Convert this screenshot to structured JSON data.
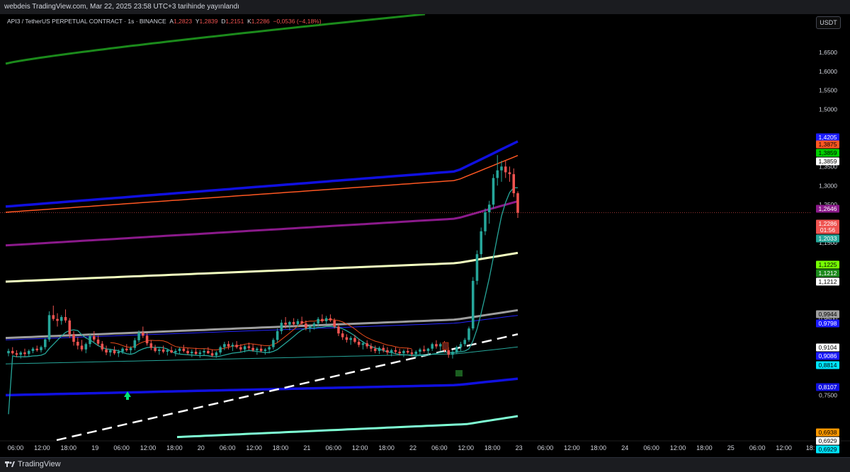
{
  "header": {
    "publish_note": "webdeis TradingView.com, Mar 22, 2025 23:58 UTC+3 tarihinde yayınlandı"
  },
  "symbol": {
    "name": "API3 / TetherUS PERPETUAL CONTRACT · 1s · BINANCE",
    "o_label": "A",
    "o_value": "1,2823",
    "h_label": "Y",
    "h_value": "1,2839",
    "l_label": "D",
    "l_value": "1,2151",
    "c_label": "K",
    "c_value": "1,2286",
    "change": "−0,0536 (−4,18%)"
  },
  "currency_button": "USDT",
  "brand": "TradingView",
  "colors": {
    "background": "#000000",
    "up": "#26a69a",
    "down": "#ef5350",
    "green_band": "#1b8a1b",
    "blue_band": "#1010e0",
    "orange_ma": "#ff5722",
    "purple_ma": "#8b1a8b",
    "yellow_band": "#f3ffc0",
    "gray_ma": "#9e9e9e",
    "teal_ma": "#26a69a",
    "aqua_band": "#7fffd4",
    "white_dash": "#ffffff"
  },
  "chart_data": {
    "type": "candlestick",
    "timeframe": "1h",
    "x_ticks": [
      "06:00",
      "12:00",
      "18:00",
      "19",
      "06:00",
      "12:00",
      "18:00",
      "20",
      "06:00",
      "12:00",
      "18:00",
      "21",
      "06:00",
      "12:00",
      "18:00",
      "22",
      "06:00",
      "12:00",
      "18:00",
      "23",
      "06:00",
      "12:00",
      "18:00",
      "24",
      "06:00",
      "12:00",
      "18:00",
      "25",
      "06:00",
      "12:00",
      "18:"
    ],
    "y_ticks": [
      "1,6500",
      "1,6000",
      "1,5500",
      "1,5000",
      "1,3500",
      "1,3000",
      "1,2500",
      "1,1500",
      "1,0500",
      "0,9500",
      "0,8500",
      "0,7500"
    ],
    "ylim": [
      0.63,
      1.75
    ],
    "price_tags": [
      {
        "value": "1,4205",
        "bg": "#1a1aff",
        "fg": "#ffffff"
      },
      {
        "value": "1,3875",
        "bg": "#ff5722",
        "fg": "#000000"
      },
      {
        "value": "1,3859",
        "bg": "#00d000",
        "fg": "#000000"
      },
      {
        "value": "1,3859",
        "bg": "#ffffff",
        "fg": "#000000"
      },
      {
        "value": "1,2646",
        "bg": "#8b1a8b",
        "fg": "#ffffff"
      },
      {
        "value": "1,2286",
        "bg": "#ef5350",
        "fg": "#ffffff"
      },
      {
        "value": "01:56",
        "bg": "#ef5350",
        "fg": "#ffffff"
      },
      {
        "value": "1,2033",
        "bg": "#26a69a",
        "fg": "#ffffff"
      },
      {
        "value": "1,1225",
        "bg": "#76ff03",
        "fg": "#000000"
      },
      {
        "value": "1,1212",
        "bg": "#1b8a1b",
        "fg": "#ffffff"
      },
      {
        "value": "1,1212",
        "bg": "#ffffff",
        "fg": "#000000"
      },
      {
        "value": "0,9944",
        "bg": "#9e9e9e",
        "fg": "#000000"
      },
      {
        "value": "0,9798",
        "bg": "#1a1aff",
        "fg": "#ffffff"
      },
      {
        "value": "0,9104",
        "bg": "#ffffff",
        "fg": "#000000"
      },
      {
        "value": "0,9086",
        "bg": "#1a1aff",
        "fg": "#ffffff"
      },
      {
        "value": "0,8814",
        "bg": "#00e5ff",
        "fg": "#000000"
      },
      {
        "value": "0,8107",
        "bg": "#1010e0",
        "fg": "#ffffff"
      },
      {
        "value": "0,6938",
        "bg": "#ff9800",
        "fg": "#000000"
      },
      {
        "value": "0,6929",
        "bg": "#ffffff",
        "fg": "#000000"
      },
      {
        "value": "0,6929",
        "bg": "#00e5ff",
        "fg": "#000000"
      }
    ],
    "candles": [
      [
        0.86,
        0.872,
        0.852,
        0.866
      ],
      [
        0.866,
        0.876,
        0.856,
        0.86
      ],
      [
        0.86,
        0.868,
        0.85,
        0.856
      ],
      [
        0.856,
        0.866,
        0.846,
        0.862
      ],
      [
        0.862,
        0.872,
        0.852,
        0.858
      ],
      [
        0.858,
        0.87,
        0.852,
        0.866
      ],
      [
        0.866,
        0.876,
        0.86,
        0.872
      ],
      [
        0.872,
        0.88,
        0.864,
        0.868
      ],
      [
        0.868,
        0.88,
        0.862,
        0.876
      ],
      [
        0.876,
        0.9,
        0.87,
        0.896
      ],
      [
        0.896,
        0.97,
        0.89,
        0.96
      ],
      [
        0.96,
        0.985,
        0.945,
        0.95
      ],
      [
        0.95,
        0.965,
        0.93,
        0.945
      ],
      [
        0.945,
        0.96,
        0.935,
        0.955
      ],
      [
        0.955,
        0.975,
        0.94,
        0.946
      ],
      [
        0.946,
        0.952,
        0.9,
        0.91
      ],
      [
        0.91,
        0.918,
        0.88,
        0.89
      ],
      [
        0.89,
        0.902,
        0.87,
        0.88
      ],
      [
        0.88,
        0.895,
        0.865,
        0.87
      ],
      [
        0.87,
        0.888,
        0.86,
        0.884
      ],
      [
        0.884,
        0.91,
        0.876,
        0.905
      ],
      [
        0.905,
        0.918,
        0.89,
        0.896
      ],
      [
        0.896,
        0.906,
        0.88,
        0.885
      ],
      [
        0.885,
        0.892,
        0.865,
        0.87
      ],
      [
        0.87,
        0.88,
        0.855,
        0.862
      ],
      [
        0.862,
        0.872,
        0.852,
        0.868
      ],
      [
        0.868,
        0.878,
        0.856,
        0.86
      ],
      [
        0.86,
        0.87,
        0.85,
        0.864
      ],
      [
        0.864,
        0.876,
        0.858,
        0.872
      ],
      [
        0.872,
        0.884,
        0.864,
        0.868
      ],
      [
        0.868,
        0.878,
        0.858,
        0.874
      ],
      [
        0.874,
        0.9,
        0.868,
        0.894
      ],
      [
        0.894,
        0.92,
        0.888,
        0.914
      ],
      [
        0.914,
        0.93,
        0.9,
        0.906
      ],
      [
        0.906,
        0.912,
        0.88,
        0.886
      ],
      [
        0.886,
        0.894,
        0.868,
        0.874
      ],
      [
        0.874,
        0.882,
        0.862,
        0.866
      ],
      [
        0.866,
        0.874,
        0.856,
        0.87
      ],
      [
        0.87,
        0.88,
        0.86,
        0.864
      ],
      [
        0.864,
        0.872,
        0.854,
        0.868
      ],
      [
        0.868,
        0.878,
        0.86,
        0.862
      ],
      [
        0.862,
        0.872,
        0.852,
        0.866
      ],
      [
        0.866,
        0.876,
        0.858,
        0.872
      ],
      [
        0.872,
        0.882,
        0.862,
        0.866
      ],
      [
        0.866,
        0.874,
        0.856,
        0.86
      ],
      [
        0.86,
        0.87,
        0.85,
        0.864
      ],
      [
        0.864,
        0.874,
        0.856,
        0.858
      ],
      [
        0.858,
        0.868,
        0.848,
        0.862
      ],
      [
        0.862,
        0.872,
        0.854,
        0.866
      ],
      [
        0.866,
        0.876,
        0.858,
        0.86
      ],
      [
        0.86,
        0.87,
        0.85,
        0.854
      ],
      [
        0.854,
        0.866,
        0.848,
        0.862
      ],
      [
        0.862,
        0.88,
        0.856,
        0.876
      ],
      [
        0.876,
        0.89,
        0.868,
        0.884
      ],
      [
        0.884,
        0.892,
        0.87,
        0.878
      ],
      [
        0.878,
        0.888,
        0.866,
        0.882
      ],
      [
        0.882,
        0.892,
        0.872,
        0.876
      ],
      [
        0.876,
        0.884,
        0.864,
        0.87
      ],
      [
        0.87,
        0.882,
        0.862,
        0.878
      ],
      [
        0.878,
        0.888,
        0.868,
        0.874
      ],
      [
        0.874,
        0.884,
        0.864,
        0.868
      ],
      [
        0.868,
        0.876,
        0.856,
        0.872
      ],
      [
        0.872,
        0.882,
        0.862,
        0.866
      ],
      [
        0.866,
        0.874,
        0.856,
        0.87
      ],
      [
        0.87,
        0.88,
        0.86,
        0.876
      ],
      [
        0.876,
        0.9,
        0.87,
        0.895
      ],
      [
        0.895,
        0.925,
        0.888,
        0.918
      ],
      [
        0.918,
        0.948,
        0.91,
        0.94
      ],
      [
        0.94,
        0.955,
        0.925,
        0.935
      ],
      [
        0.935,
        0.945,
        0.92,
        0.942
      ],
      [
        0.942,
        0.952,
        0.93,
        0.936
      ],
      [
        0.936,
        0.95,
        0.928,
        0.944
      ],
      [
        0.944,
        0.956,
        0.934,
        0.938
      ],
      [
        0.938,
        0.946,
        0.92,
        0.926
      ],
      [
        0.926,
        0.934,
        0.915,
        0.93
      ],
      [
        0.93,
        0.942,
        0.922,
        0.938
      ],
      [
        0.938,
        0.955,
        0.93,
        0.95
      ],
      [
        0.95,
        0.962,
        0.94,
        0.944
      ],
      [
        0.944,
        0.958,
        0.936,
        0.952
      ],
      [
        0.952,
        0.962,
        0.942,
        0.946
      ],
      [
        0.946,
        0.952,
        0.925,
        0.93
      ],
      [
        0.93,
        0.936,
        0.905,
        0.912
      ],
      [
        0.912,
        0.92,
        0.895,
        0.902
      ],
      [
        0.902,
        0.91,
        0.888,
        0.895
      ],
      [
        0.895,
        0.905,
        0.882,
        0.9
      ],
      [
        0.9,
        0.908,
        0.886,
        0.89
      ],
      [
        0.89,
        0.898,
        0.876,
        0.882
      ],
      [
        0.882,
        0.892,
        0.87,
        0.886
      ],
      [
        0.886,
        0.894,
        0.872,
        0.878
      ],
      [
        0.878,
        0.886,
        0.864,
        0.872
      ],
      [
        0.872,
        0.88,
        0.86,
        0.866
      ],
      [
        0.866,
        0.878,
        0.858,
        0.874
      ],
      [
        0.874,
        0.882,
        0.862,
        0.868
      ],
      [
        0.868,
        0.876,
        0.856,
        0.862
      ],
      [
        0.862,
        0.872,
        0.852,
        0.868
      ],
      [
        0.868,
        0.876,
        0.858,
        0.864
      ],
      [
        0.864,
        0.872,
        0.854,
        0.86
      ],
      [
        0.86,
        0.87,
        0.85,
        0.866
      ],
      [
        0.866,
        0.874,
        0.858,
        0.862
      ],
      [
        0.862,
        0.87,
        0.852,
        0.858
      ],
      [
        0.858,
        0.868,
        0.848,
        0.864
      ],
      [
        0.864,
        0.874,
        0.856,
        0.87
      ],
      [
        0.87,
        0.88,
        0.862,
        0.866
      ],
      [
        0.866,
        0.874,
        0.856,
        0.872
      ],
      [
        0.872,
        0.888,
        0.866,
        0.884
      ],
      [
        0.884,
        0.894,
        0.872,
        0.878
      ],
      [
        0.878,
        0.888,
        0.866,
        0.884
      ],
      [
        0.884,
        0.892,
        0.862,
        0.868
      ],
      [
        0.868,
        0.876,
        0.848,
        0.856
      ],
      [
        0.856,
        0.868,
        0.846,
        0.864
      ],
      [
        0.864,
        0.88,
        0.858,
        0.876
      ],
      [
        0.876,
        0.89,
        0.866,
        0.884
      ],
      [
        0.884,
        0.9,
        0.878,
        0.895
      ],
      [
        0.895,
        0.93,
        0.89,
        0.925
      ],
      [
        0.925,
        1.06,
        0.92,
        1.05
      ],
      [
        1.05,
        1.13,
        1.04,
        1.12
      ],
      [
        1.12,
        1.19,
        1.11,
        1.18
      ],
      [
        1.18,
        1.24,
        1.17,
        1.23
      ],
      [
        1.23,
        1.26,
        1.2,
        1.25
      ],
      [
        1.25,
        1.33,
        1.24,
        1.32
      ],
      [
        1.32,
        1.38,
        1.3,
        1.34
      ],
      [
        1.34,
        1.365,
        1.31,
        1.35
      ],
      [
        1.35,
        1.365,
        1.32,
        1.335
      ],
      [
        1.335,
        1.35,
        1.31,
        1.33
      ],
      [
        1.33,
        1.345,
        1.27,
        1.28
      ],
      [
        1.28,
        1.285,
        1.215,
        1.229
      ]
    ]
  }
}
